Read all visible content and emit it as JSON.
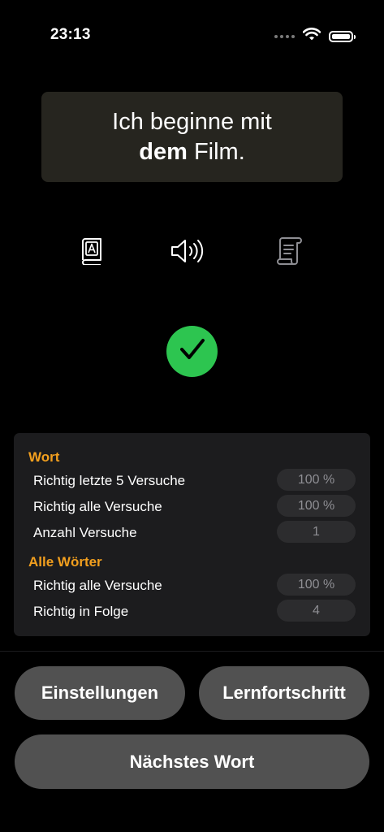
{
  "status_bar": {
    "time": "23:13"
  },
  "sentence": {
    "line1": "Ich beginne mit",
    "article": "dem",
    "noun": "Film."
  },
  "actions": [
    {
      "icon": "dictionary-icon"
    },
    {
      "icon": "speaker-icon"
    },
    {
      "icon": "scroll-icon"
    }
  ],
  "result": {
    "icon": "checkmark-icon",
    "color": "#2dc550"
  },
  "stats": {
    "word_title": "Wort",
    "word_rows": [
      {
        "label": "Richtig letzte 5 Versuche",
        "value": "100 %"
      },
      {
        "label": "Richtig alle Versuche",
        "value": "100 %"
      },
      {
        "label": "Anzahl Versuche",
        "value": "1"
      }
    ],
    "all_title": "Alle Wörter",
    "all_rows": [
      {
        "label": "Richtig alle Versuche",
        "value": "100 %"
      },
      {
        "label": "Richtig in Folge",
        "value": "4"
      }
    ]
  },
  "buttons": {
    "settings": "Einstellungen",
    "progress": "Lernfortschritt",
    "next": "Nächstes Wort"
  },
  "colors": {
    "accent": "#f29f1e",
    "background": "#000000",
    "panel": "#1c1c1e",
    "button": "#515151"
  }
}
